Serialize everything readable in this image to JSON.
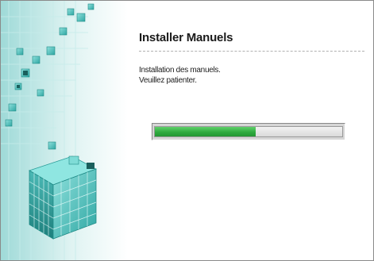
{
  "window": {
    "title": "Installer Manuels",
    "message_line1": "Installation des manuels.",
    "message_line2": "Veuillez patienter.",
    "progress": {
      "value": 0.54
    }
  },
  "colors": {
    "progress_fill": "#2faa3f",
    "art_cube": "#5fc4c0"
  },
  "icons": {
    "side_art": "cube-mosaic-art"
  }
}
